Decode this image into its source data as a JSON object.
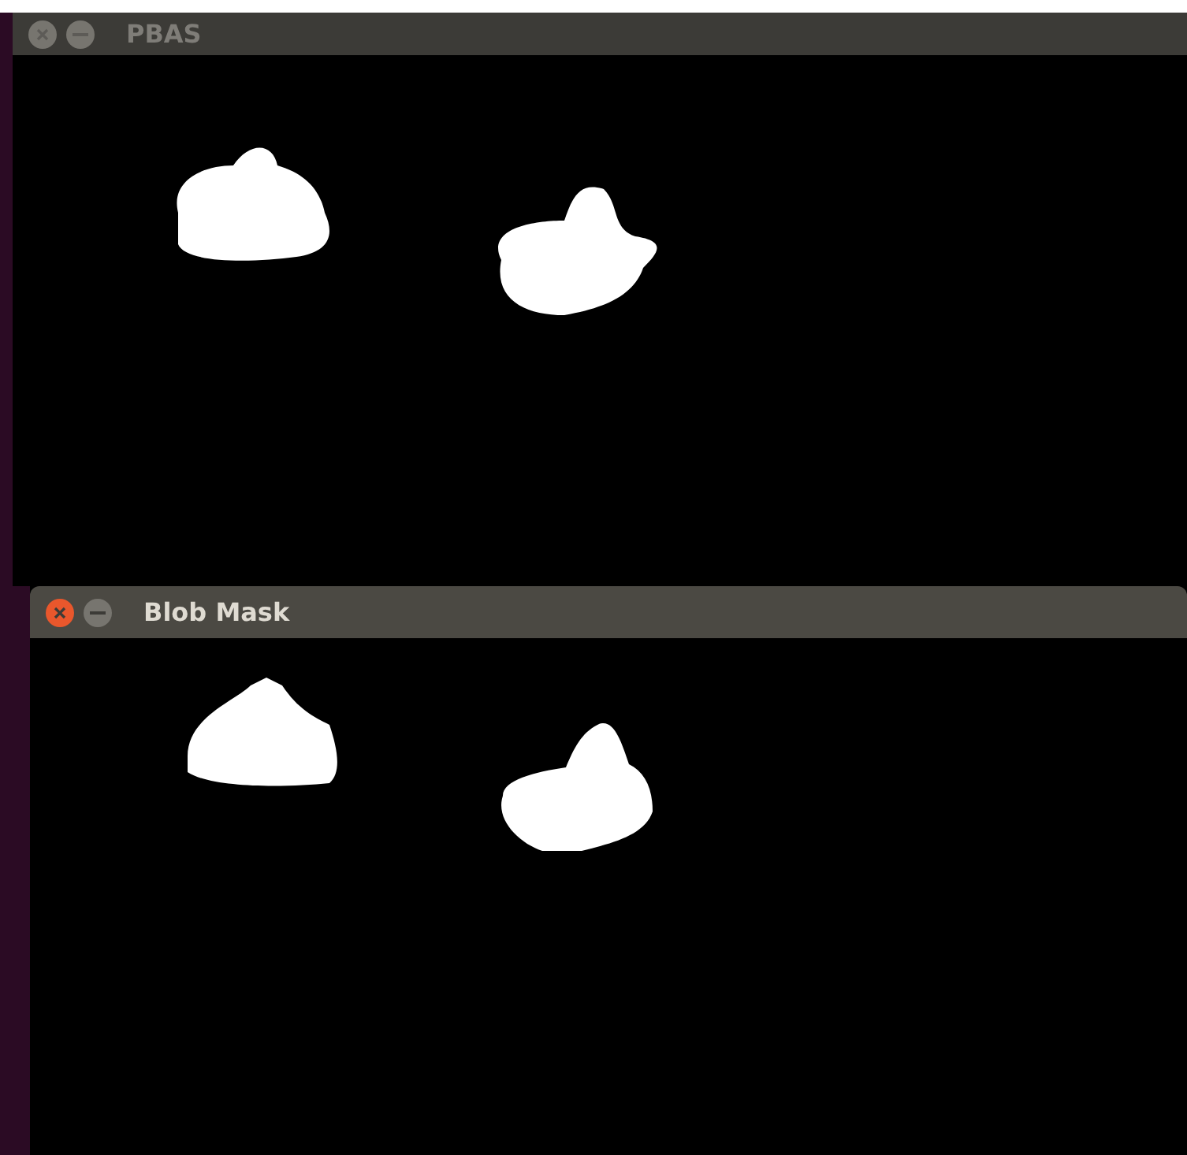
{
  "windows": [
    {
      "title": "PBAS",
      "active": false
    },
    {
      "title": "Blob Mask",
      "active": true
    }
  ]
}
